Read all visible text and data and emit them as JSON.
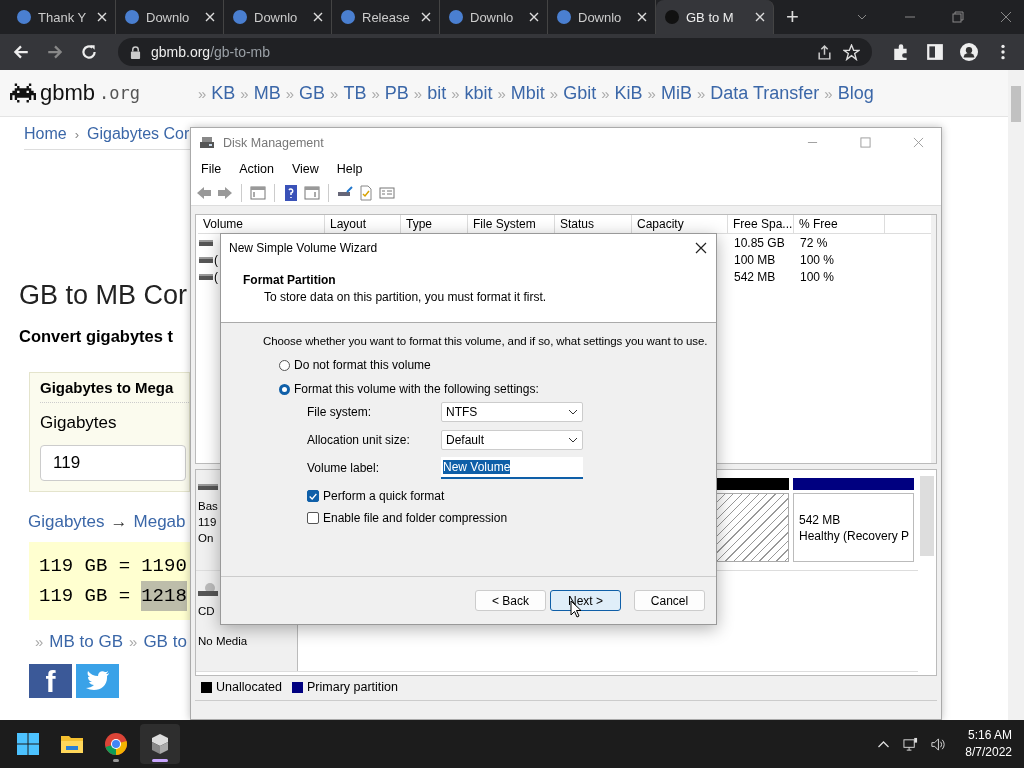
{
  "browser": {
    "tabs": [
      {
        "title": "Thank Y",
        "selected": false
      },
      {
        "title": "Downlo",
        "selected": false
      },
      {
        "title": "Downlo",
        "selected": false
      },
      {
        "title": "Release",
        "selected": false
      },
      {
        "title": "Downlo",
        "selected": false
      },
      {
        "title": "Downlo",
        "selected": false
      },
      {
        "title": "GB to M",
        "selected": true
      }
    ],
    "new_tab": "+",
    "url": "**gbmb.org**/gb-to-mb"
  },
  "site": {
    "logo": "gbmb",
    "logo_suffix": ".org",
    "nav": [
      {
        "prefix": "»",
        "label": "KB"
      },
      {
        "prefix": "»",
        "label": "MB"
      },
      {
        "prefix": "»",
        "label": "GB"
      },
      {
        "prefix": "»",
        "label": "TB"
      },
      {
        "prefix": "»",
        "label": "PB"
      },
      {
        "prefix": "»",
        "label": "bit"
      },
      {
        "prefix": "»",
        "label": "kbit"
      },
      {
        "prefix": "»",
        "label": "Mbit"
      },
      {
        "prefix": "»",
        "label": "Gbit"
      },
      {
        "prefix": "»",
        "label": "KiB"
      },
      {
        "prefix": "»",
        "label": "MiB"
      },
      {
        "prefix": "»",
        "label": "Data Transfer"
      },
      {
        "prefix": "»",
        "label": "Blog"
      }
    ],
    "breadcrumb": {
      "home": "Home",
      "separator": "›",
      "current": "Gigabytes Cor"
    },
    "title": "GB to MB Cor",
    "subtitle": "Convert gigabytes t",
    "card": {
      "title": "Gigabytes to Mega",
      "label": "Gigabytes",
      "value": "119"
    },
    "direction": {
      "from": "Gigabytes",
      "arrow": "→",
      "to": "Megab"
    },
    "results": [
      {
        "lhs": "119 GB =",
        "rhs": "1190",
        "selected": false
      },
      {
        "lhs": "119 GB =",
        "rhs": "1218",
        "selected": true
      }
    ],
    "related": [
      {
        "prefix": "»",
        "label": "MB to GB"
      },
      {
        "prefix": "»",
        "label": "GB to"
      }
    ],
    "social": [
      {
        "kind": "facebook",
        "label": "f"
      },
      {
        "kind": "twitter"
      }
    ]
  },
  "disk_management": {
    "title": "Disk Management",
    "menu": [
      "File",
      "Action",
      "View",
      "Help"
    ],
    "columns": [
      "Volume",
      "Layout",
      "Type",
      "File System",
      "Status",
      "Capacity",
      "Free Spa...",
      "% Free"
    ],
    "rows": [
      {
        "free_space": "10.85 GB",
        "percent_free": "72 %"
      },
      {
        "volume": "(",
        "free_space": "100 MB",
        "percent_free": "100 %"
      },
      {
        "volume": "(",
        "free_space": "542 MB",
        "percent_free": "100 %"
      }
    ],
    "disks": [
      {
        "kind": "disk",
        "lines": [
          "Bas",
          "119",
          "On"
        ],
        "partitions": [
          {
            "kind": "unallocated",
            "color": "#000000"
          },
          {
            "kind": "primary",
            "color": "#000080",
            "size": "542 MB",
            "status": "Healthy (Recovery P"
          }
        ]
      },
      {
        "kind": "cdrom",
        "lines": [
          "CD"
        ],
        "note": "No Media"
      }
    ],
    "legend": [
      {
        "label": "Unallocated",
        "color": "#000000"
      },
      {
        "label": "Primary partition",
        "color": "#000080"
      }
    ]
  },
  "wizard": {
    "title": "New Simple Volume Wizard",
    "heading": "Format Partition",
    "subheading": "To store data on this partition, you must format it first.",
    "prompt": "Choose whether you want to format this volume, and if so, what settings you want to use.",
    "options": [
      {
        "label": "Do not format this volume",
        "selected": false
      },
      {
        "label": "Format this volume with the following settings:",
        "selected": true
      }
    ],
    "settings": [
      {
        "kind": "select",
        "label": "File system:",
        "value": "NTFS"
      },
      {
        "kind": "select",
        "label": "Allocation unit size:",
        "value": "Default"
      },
      {
        "kind": "text",
        "label": "Volume label:",
        "value": "New Volume",
        "selected": true
      }
    ],
    "checks": [
      {
        "label": "Perform a quick format",
        "checked": true
      },
      {
        "label": "Enable file and folder compression",
        "checked": false
      }
    ],
    "buttons": [
      {
        "label": "< Back",
        "default": false
      },
      {
        "label": "Next >",
        "default": true
      },
      {
        "label": "Cancel",
        "default": false
      }
    ]
  },
  "taskbar": {
    "apps": [
      {
        "kind": "start",
        "running": false,
        "selected": false
      },
      {
        "kind": "files",
        "running": false,
        "selected": false
      },
      {
        "kind": "browser",
        "running": true,
        "selected": false
      },
      {
        "kind": "disk",
        "running": true,
        "selected": true
      }
    ],
    "time": "5:16 AM",
    "date": "8/7/2022"
  }
}
